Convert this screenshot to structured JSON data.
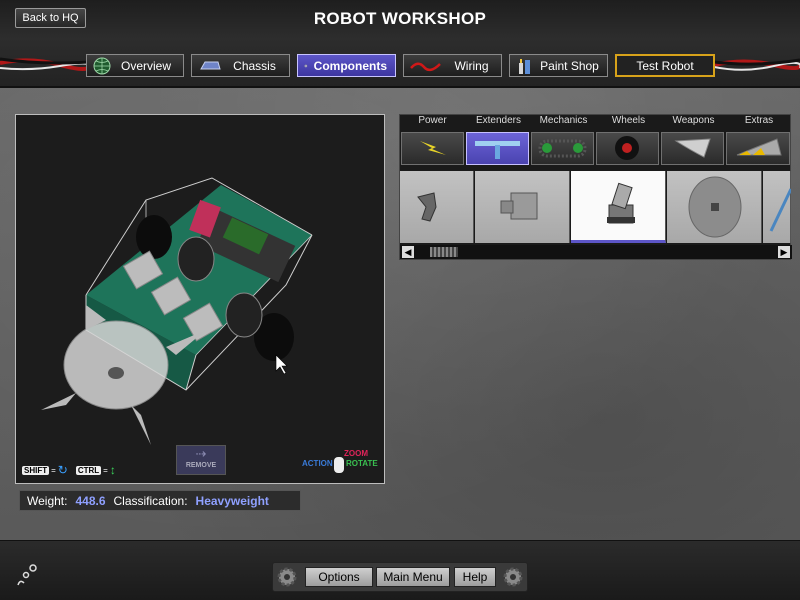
{
  "header": {
    "back_label": "Back to HQ",
    "title": "ROBOT WORKSHOP"
  },
  "tabs": [
    {
      "label": "Overview",
      "icon": "globe-icon"
    },
    {
      "label": "Chassis",
      "icon": "chassis-icon"
    },
    {
      "label": "Components",
      "icon": "gear-icon",
      "active": true
    },
    {
      "label": "Wiring",
      "icon": "wire-icon"
    },
    {
      "label": "Paint Shop",
      "icon": "paint-icon"
    },
    {
      "label": "Test Robot",
      "icon": "hazard-stripe"
    }
  ],
  "viewport": {
    "hint_shift": "SHIFT",
    "hint_ctrl": "CTRL",
    "hint_equals": "=",
    "remove_label": "REMOVE",
    "action_label": "ACTION",
    "zoom_label": "ZOOM",
    "rotate_label": "ROTATE"
  },
  "stats": {
    "weight_label": "Weight:",
    "weight_value": "448.6",
    "class_label": "Classification:",
    "class_value": "Heavyweight"
  },
  "parts_panel": {
    "categories": [
      "Power",
      "Extenders",
      "Mechanics",
      "Wheels",
      "Weapons",
      "Extras"
    ],
    "active_category": "Extenders"
  },
  "bottom": {
    "options_label": "Options",
    "main_menu_label": "Main Menu",
    "help_label": "Help"
  },
  "colors": {
    "accent": "#5d56c8",
    "value_text": "#8fa0ff",
    "hazard": "#d7a21a"
  }
}
